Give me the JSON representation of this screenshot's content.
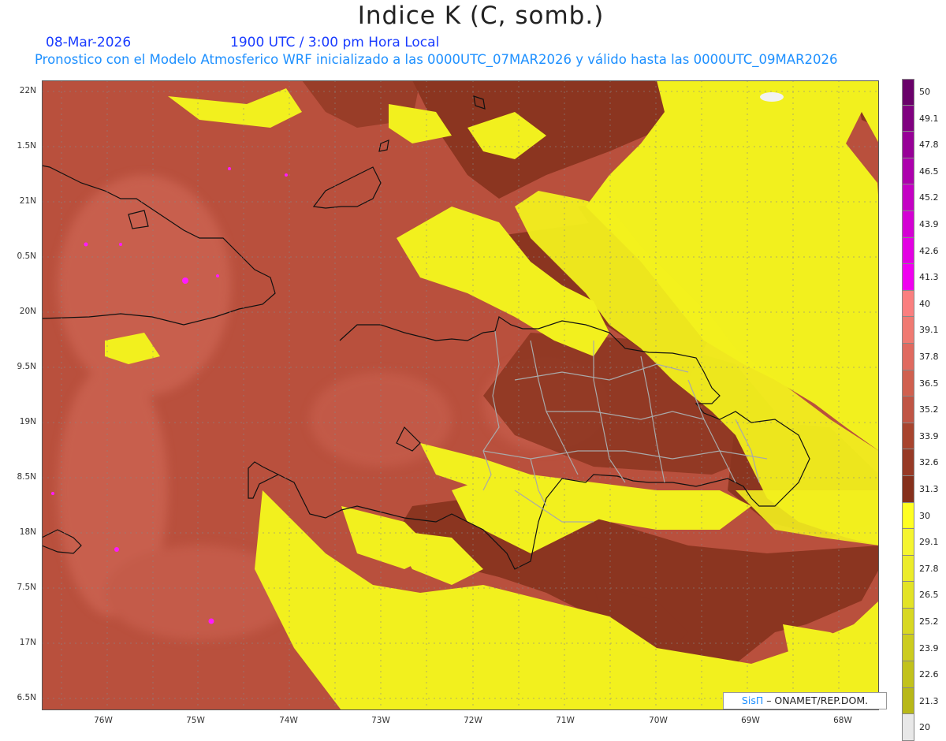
{
  "header": {
    "title": "Indice K (C, somb.)",
    "date": "08-Mar-2026",
    "time": "1900 UTC / 3:00 pm Hora Local",
    "subtitle": "Pronostico con el Modelo Atmosferico WRF inicializado a las 0000UTC_07MAR2026 y válido hasta las  0000UTC_09MAR2026"
  },
  "axes": {
    "lat_labels": [
      "22N",
      "1.5N",
      "21N",
      "0.5N",
      "20N",
      "9.5N",
      "19N",
      "8.5N",
      "18N",
      "7.5N",
      "17N",
      "6.5N"
    ],
    "lon_labels": [
      "76W",
      "75W",
      "74W",
      "73W",
      "72W",
      "71W",
      "70W",
      "69W",
      "68W"
    ]
  },
  "colorbar": {
    "labels": [
      "50",
      "49.1",
      "47.8",
      "46.5",
      "45.2",
      "43.9",
      "42.6",
      "41.3",
      "40",
      "39.1",
      "37.8",
      "36.5",
      "35.2",
      "33.9",
      "32.6",
      "31.3",
      "30",
      "29.1",
      "27.8",
      "26.5",
      "25.2",
      "23.9",
      "22.6",
      "21.3",
      "20"
    ],
    "colors": [
      "#6a006a",
      "#800080",
      "#970097",
      "#ad00ad",
      "#c400c4",
      "#d400d4",
      "#e300e3",
      "#f000f0",
      "#fa7f7f",
      "#f07a72",
      "#e06a60",
      "#d0604f",
      "#c05545",
      "#a8442e",
      "#973a26",
      "#86301c",
      "#ffff22",
      "#f5f530",
      "#ecec2a",
      "#e3e326",
      "#d8d822",
      "#cccc1f",
      "#c2c21c",
      "#b8b818",
      "#e8e8e8"
    ]
  },
  "credit": {
    "brand": "SisΠ",
    "text": " – ONAMET/REP.DOM."
  },
  "palette": {
    "yellow": "#f2f01e",
    "dark_brown": "#8b3520",
    "mid_brown": "#b04a38",
    "salmon": "#c9604f",
    "magenta": "#ff00ff",
    "coast": "#111111",
    "provinces": "#a9a9a9"
  }
}
